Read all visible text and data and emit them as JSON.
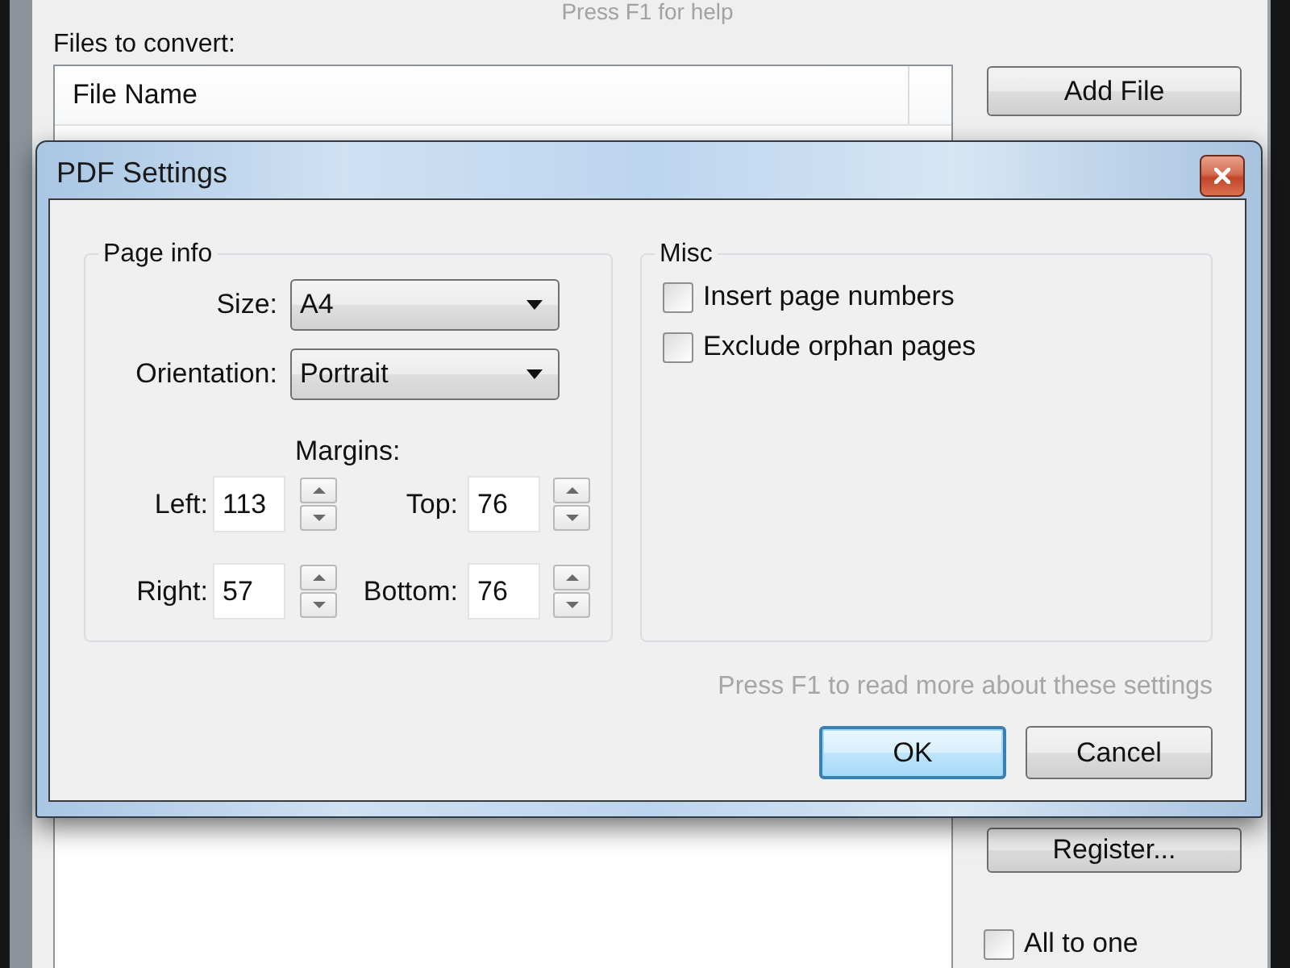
{
  "main_window": {
    "help_text": "Press F1 for help",
    "files_label": "Files to convert:",
    "file_list": {
      "columns": [
        "File Name"
      ]
    },
    "add_file_button": {
      "label": "Add File"
    },
    "register_button": {
      "label": "Register..."
    },
    "all_to_one": {
      "label": "All to one",
      "checked": false
    }
  },
  "dialog": {
    "title": "PDF Settings",
    "page_info": {
      "title": "Page info",
      "size": {
        "label": "Size:",
        "value": "A4"
      },
      "orientation": {
        "label": "Orientation:",
        "value": "Portrait"
      },
      "margins_title": "Margins:",
      "margins": [
        {
          "label": "Left:",
          "value": "113"
        },
        {
          "label": "Top:",
          "value": "76"
        },
        {
          "label": "Right:",
          "value": "57"
        },
        {
          "label": "Bottom:",
          "value": "76"
        }
      ]
    },
    "misc": {
      "title": "Misc",
      "options": [
        {
          "label": "Insert page numbers",
          "checked": false
        },
        {
          "label": "Exclude orphan pages",
          "checked": false
        }
      ]
    },
    "hint": "Press F1 to read more about these settings",
    "buttons": [
      {
        "label": "OK",
        "focused": true
      },
      {
        "label": "Cancel",
        "focused": false
      }
    ]
  }
}
